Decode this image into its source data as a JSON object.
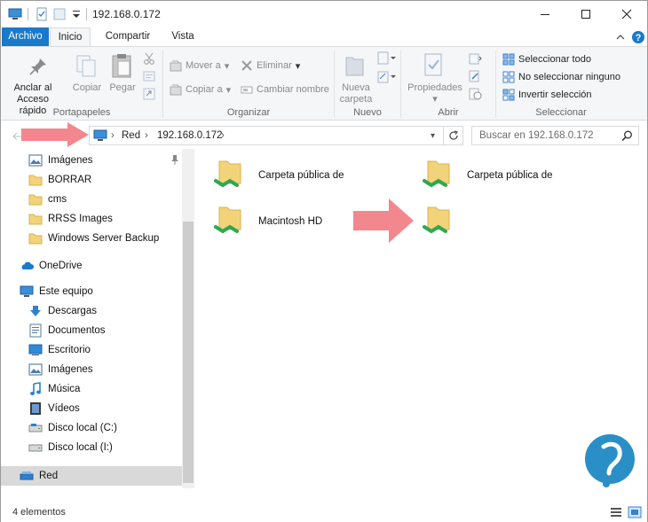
{
  "window": {
    "title": "192.168.0.172",
    "minimize_icon": "minimize-icon",
    "maximize_icon": "maximize-icon",
    "close_icon": "close-icon"
  },
  "tabs": [
    {
      "label": "Archivo"
    },
    {
      "label": "Inicio"
    },
    {
      "label": "Compartir"
    },
    {
      "label": "Vista"
    }
  ],
  "ribbon": {
    "portapapeles": {
      "label": "Portapapeles",
      "pin_line1": "Anclar al",
      "pin_line2": "Acceso rápido",
      "copy": "Copiar",
      "paste": "Pegar"
    },
    "organizar": {
      "label": "Organizar",
      "move_to": "Mover a",
      "copy_to": "Copiar a",
      "delete": "Eliminar",
      "rename": "Cambiar nombre"
    },
    "nuevo": {
      "label": "Nuevo",
      "new_folder_line1": "Nueva",
      "new_folder_line2": "carpeta"
    },
    "abrir": {
      "label": "Abrir",
      "properties": "Propiedades"
    },
    "seleccionar": {
      "label": "Seleccionar",
      "select_all": "Seleccionar todo",
      "select_none": "No seleccionar ninguno",
      "invert": "Invertir selección"
    }
  },
  "address": {
    "segments": [
      "Red",
      "192.168.0.172"
    ],
    "search_placeholder": "Buscar en 192.168.0.172"
  },
  "nav": {
    "quick": [
      "Imágenes",
      "BORRAR",
      "cms",
      "RRSS Images",
      "Windows Server Backup"
    ],
    "onedrive": "OneDrive",
    "thispc": "Este equipo",
    "pc_items": [
      "Descargas",
      "Documentos",
      "Escritorio",
      "Imágenes",
      "Música",
      "Vídeos",
      "Disco local (C:)",
      "Disco local (I:)"
    ],
    "network": "Red"
  },
  "files": [
    {
      "name": "Carpeta pública de"
    },
    {
      "name": "Carpeta pública de"
    },
    {
      "name": "Macintosh HD"
    },
    {
      "name": ""
    }
  ],
  "status": {
    "count": "4 elementos"
  },
  "colors": {
    "accent": "#1979ca",
    "folder": "#f3d37a",
    "share": "#2fa84f",
    "annotation": "#f3878e",
    "logo": "#2a8fc7"
  }
}
